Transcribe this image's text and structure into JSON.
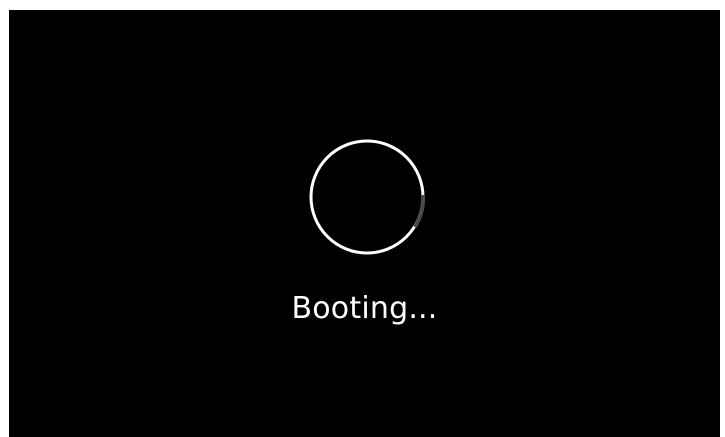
{
  "boot_screen": {
    "status_text": "Booting...",
    "spinner_icon": "loading-spinner-icon",
    "background_color": "#000000",
    "foreground_color": "#ffffff"
  }
}
